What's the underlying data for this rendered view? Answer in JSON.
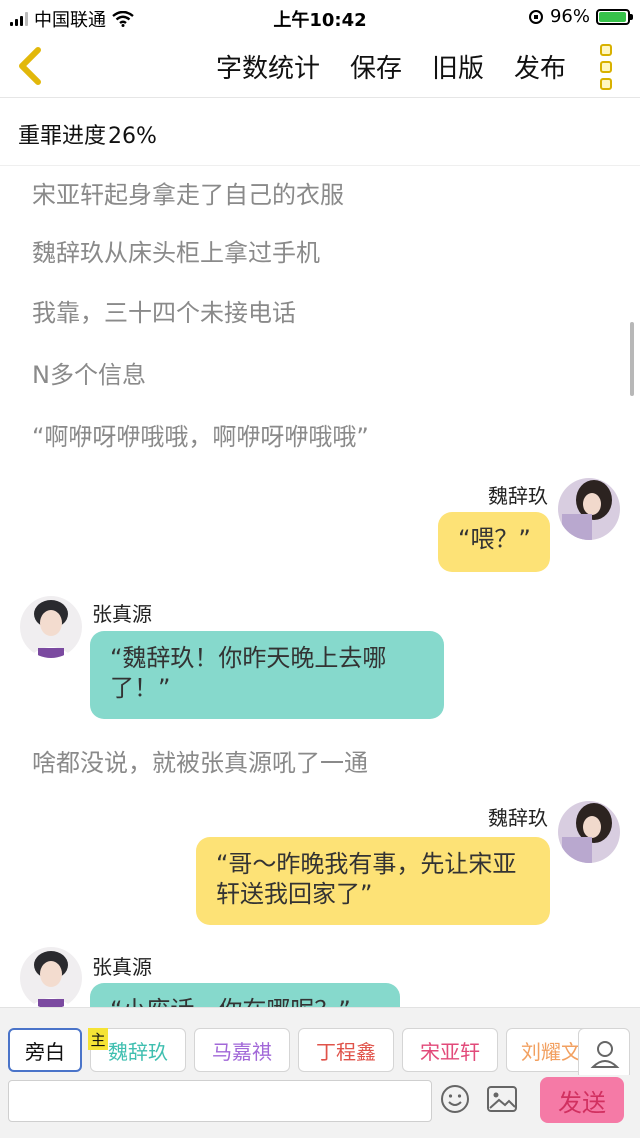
{
  "status_bar": {
    "carrier": "中国联通",
    "time": "上午10:42",
    "battery": "96%",
    "battery_level": 0.96,
    "icons": [
      "signal-icon",
      "wifi-icon",
      "orientation-lock-icon",
      "battery-icon"
    ]
  },
  "nav": {
    "back_icon": "chevron-left-icon",
    "items": [
      "字数统计",
      "保存",
      "旧版",
      "发布"
    ],
    "more_icon": "more-vertical-icon",
    "accent": "#e2b80a"
  },
  "progress": {
    "label": "重罪进度",
    "value": "26%"
  },
  "chat": {
    "narration_top": [
      "宋亚轩起身拿走了自己的衣服",
      "魏辞玖从床头柜上拿过手机",
      "我靠，三十四个未接电话",
      "N多个信息",
      "“啊咿呀咿哦哦，啊咿呀咿哦哦”"
    ],
    "messages": [
      {
        "side": "right",
        "name": "魏辞玖",
        "text": "“喂？”"
      },
      {
        "side": "left",
        "name": "张真源",
        "text": "“魏辞玖！你昨天晚上去哪了！”"
      },
      {
        "side": "right",
        "name": "魏辞玖",
        "text": "“哥～昨晚我有事，先让宋亚轩送我回家了”"
      },
      {
        "side": "left",
        "name": "张真源",
        "text": "“小废话，你在哪呢？”"
      }
    ],
    "narration_mid": "啥都没说，就被张真源吼了一通",
    "colors": {
      "right_bubble": "#fde276",
      "left_bubble": "#86d9cc",
      "narration": "#8a8a8a"
    }
  },
  "roles": {
    "items": [
      {
        "label": "旁白",
        "color": "#111111"
      },
      {
        "label": "魏辞玖",
        "color": "#3fbfb0"
      },
      {
        "label": "马嘉祺",
        "color": "#a268d8"
      },
      {
        "label": "丁程鑫",
        "color": "#e0534a"
      },
      {
        "label": "宋亚轩",
        "color": "#e24a7a"
      },
      {
        "label": "刘耀文",
        "color": "#f2a060"
      }
    ],
    "main_tag": "主",
    "user_icon": "person-icon"
  },
  "input": {
    "value": "",
    "placeholder": "",
    "emoji_icon": "smiley-icon",
    "image_icon": "image-icon",
    "send_label": "发送"
  }
}
